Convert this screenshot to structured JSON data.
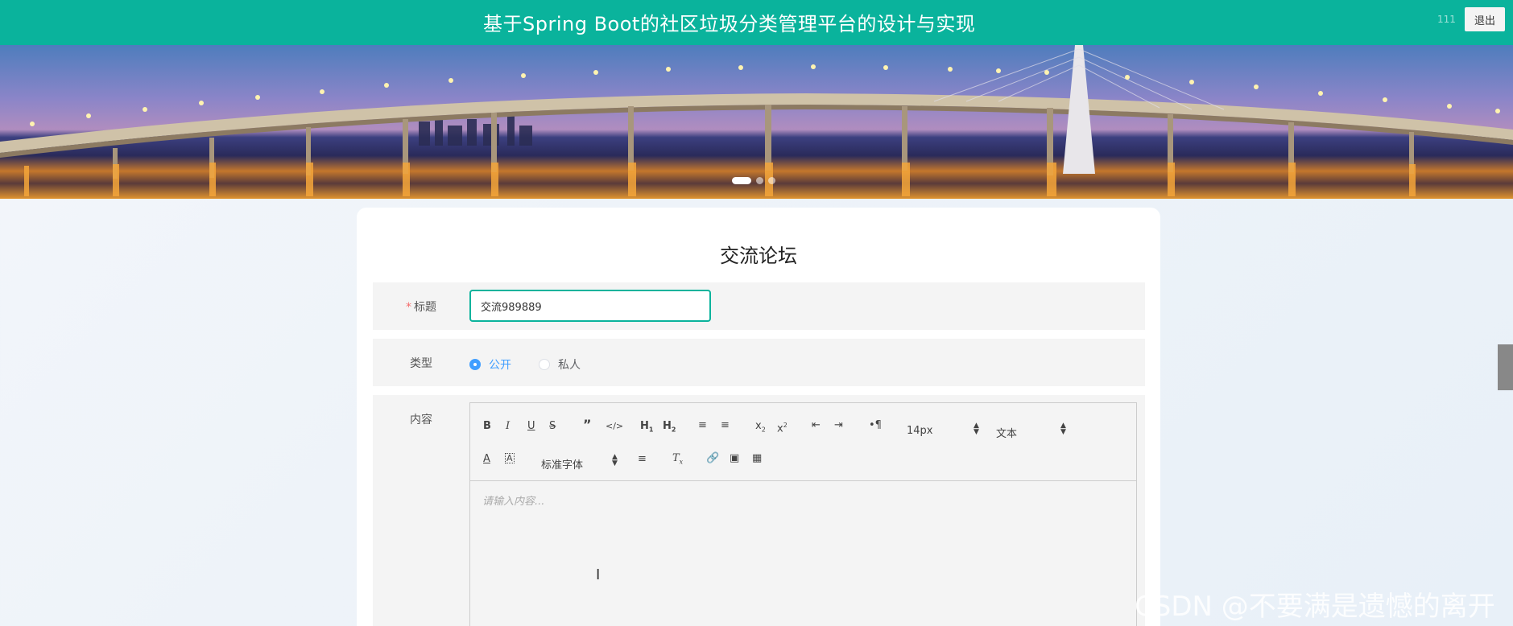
{
  "header": {
    "title": "基于Spring Boot的社区垃圾分类管理平台的设计与实现",
    "user": "111",
    "logout_label": "退出"
  },
  "banner": {
    "slide_count": 3,
    "active_slide": 1
  },
  "form": {
    "heading": "交流论坛",
    "title_label": "标题",
    "title_required_mark": "*",
    "title_value": "交流989889",
    "type_label": "类型",
    "type_options": [
      "公开",
      "私人"
    ],
    "type_selected": "公开",
    "content_label": "内容"
  },
  "editor": {
    "font_size_value": "14px",
    "paragraph_value": "文本",
    "font_family_value": "标准字体",
    "placeholder": "请输入内容..."
  },
  "watermark": "CSDN @不要满是遗憾的离开",
  "colors": {
    "header_bg": "#0ab39c",
    "accent": "#409eff",
    "required": "#f56c6c"
  }
}
